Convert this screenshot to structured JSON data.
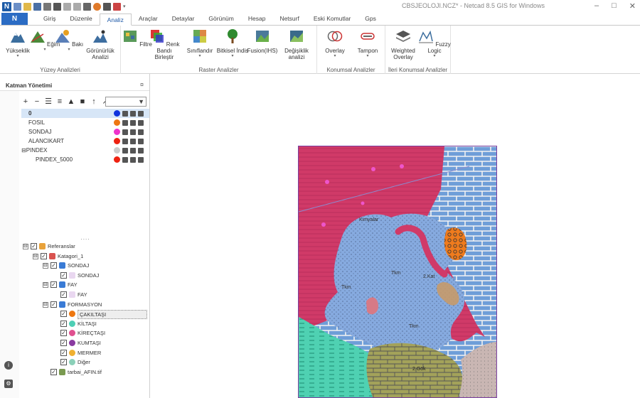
{
  "window": {
    "title": "CBSJEOLOJI.NCZ* - Netcad 8.5 GIS for Windows",
    "controls": {
      "minimize": "–",
      "maximize": "□",
      "close": "✕"
    }
  },
  "ribbon": {
    "file_label": "N",
    "tabs": [
      "Giriş",
      "Düzenle",
      "Analiz",
      "Araçlar",
      "Detaylar",
      "Görünüm",
      "Hesap",
      "Netsurf",
      "Eski Komutlar",
      "Gps"
    ],
    "active_tab": "Analiz",
    "groups": [
      {
        "label": "Yüzey Analizleri",
        "buttons": [
          {
            "id": "yukseklik",
            "label": "Yükseklik",
            "arrow": "▾"
          },
          {
            "id": "egim",
            "label": "Eğim",
            "arrow": "▾"
          },
          {
            "id": "bakı",
            "label": "Bakı",
            "arrow": "▾"
          },
          {
            "id": "gorunurluk",
            "label": "Görünürlük Analizi",
            "arrow": ""
          }
        ]
      },
      {
        "label": "Raster Analizler",
        "buttons": [
          {
            "id": "filtre",
            "label": "Filtre",
            "arrow": ""
          },
          {
            "id": "renkbandi",
            "label": "Renk Bandı Birleştir",
            "arrow": ""
          },
          {
            "id": "siniflandir",
            "label": "Sınıflandır",
            "arrow": "▾"
          },
          {
            "id": "bitkisel",
            "label": "Bitkisel İndis",
            "arrow": "▾"
          },
          {
            "id": "fusion",
            "label": "Fusion(IHS)",
            "arrow": ""
          },
          {
            "id": "degisiklik",
            "label": "Değişiklik analizi",
            "arrow": ""
          }
        ]
      },
      {
        "label": "Konumsal Analizler",
        "buttons": [
          {
            "id": "overlay",
            "label": "Overlay",
            "arrow": "▾"
          },
          {
            "id": "tampon",
            "label": "Tampon",
            "arrow": "▾"
          }
        ]
      },
      {
        "label": "İleri Konumsal Analizler",
        "buttons": [
          {
            "id": "weighted",
            "label": "Weighted Overlay",
            "arrow": ""
          },
          {
            "id": "fuzzy",
            "label": "Fuzzy Logic",
            "arrow": "▾"
          }
        ]
      }
    ]
  },
  "layer_manager": {
    "title": "Katman Yönetimi",
    "pin": "¤",
    "layers": [
      {
        "name": "0",
        "color": "#1133dd",
        "selected": true
      },
      {
        "name": "FOSIL",
        "color": "#ee7711",
        "selected": false
      },
      {
        "name": "SONDAJ",
        "color": "#ee33cc",
        "selected": false
      },
      {
        "name": "ALANCIKART",
        "color": "#ee2211",
        "selected": false
      },
      {
        "name": "⊟PINDEX",
        "color": "#cccccc",
        "selected": false
      },
      {
        "name": "PINDEX_5000",
        "color": "#ee2211",
        "selected": false
      }
    ],
    "splitter": "....",
    "tree": [
      {
        "label": "Referanslar",
        "level": 0,
        "icon_color": "#e8a23a",
        "expander": "⊟",
        "checked": true
      },
      {
        "label": "Katagori_1",
        "level": 1,
        "icon_color": "#d9534f",
        "expander": "⊟",
        "checked": true
      },
      {
        "label": "SONDAJ",
        "level": 2,
        "icon_color": "#3a7bd5",
        "expander": "⊟",
        "checked": true
      },
      {
        "label": "SONDAJ",
        "level": 3,
        "icon_color": "#e9d7f0",
        "expander": "",
        "checked": true
      },
      {
        "label": "FAY",
        "level": 2,
        "icon_color": "#3a7bd5",
        "expander": "⊟",
        "checked": true
      },
      {
        "label": "FAY",
        "level": 3,
        "icon_color": "#e9d7f0",
        "expander": "",
        "checked": true
      },
      {
        "label": "FORMASYON",
        "level": 2,
        "icon_color": "#3a7bd5",
        "expander": "⊟",
        "checked": true
      },
      {
        "label": "ÇAKILTAŞI",
        "level": 3,
        "icon_color": "#ee7711",
        "expander": "",
        "checked": true,
        "highlight": true
      },
      {
        "label": "KİLTAŞI",
        "level": 3,
        "icon_color": "#4ecfb5",
        "expander": "",
        "checked": true
      },
      {
        "label": "KİREÇTAŞI",
        "level": 3,
        "icon_color": "#e05090",
        "expander": "",
        "checked": true
      },
      {
        "label": "KUMTAŞI",
        "level": 3,
        "icon_color": "#8a3aa0",
        "expander": "",
        "checked": true
      },
      {
        "label": "MERMER",
        "level": 3,
        "icon_color": "#f0b030",
        "expander": "",
        "checked": true
      },
      {
        "label": "Diğer",
        "level": 3,
        "icon_color": "#8bd0b8",
        "expander": "",
        "checked": true
      },
      {
        "label": "tarbai_AFIN.tif",
        "level": 1,
        "icon_color": "#7a9a50",
        "expander": "",
        "checked": true
      }
    ]
  },
  "map": {
    "labels": [
      {
        "text": "Kimyalar"
      },
      {
        "text": "Tkm"
      },
      {
        "text": "Tkm"
      },
      {
        "text": "2.Kat"
      },
      {
        "text": "Tkm"
      },
      {
        "text": "2.Gök"
      }
    ]
  }
}
